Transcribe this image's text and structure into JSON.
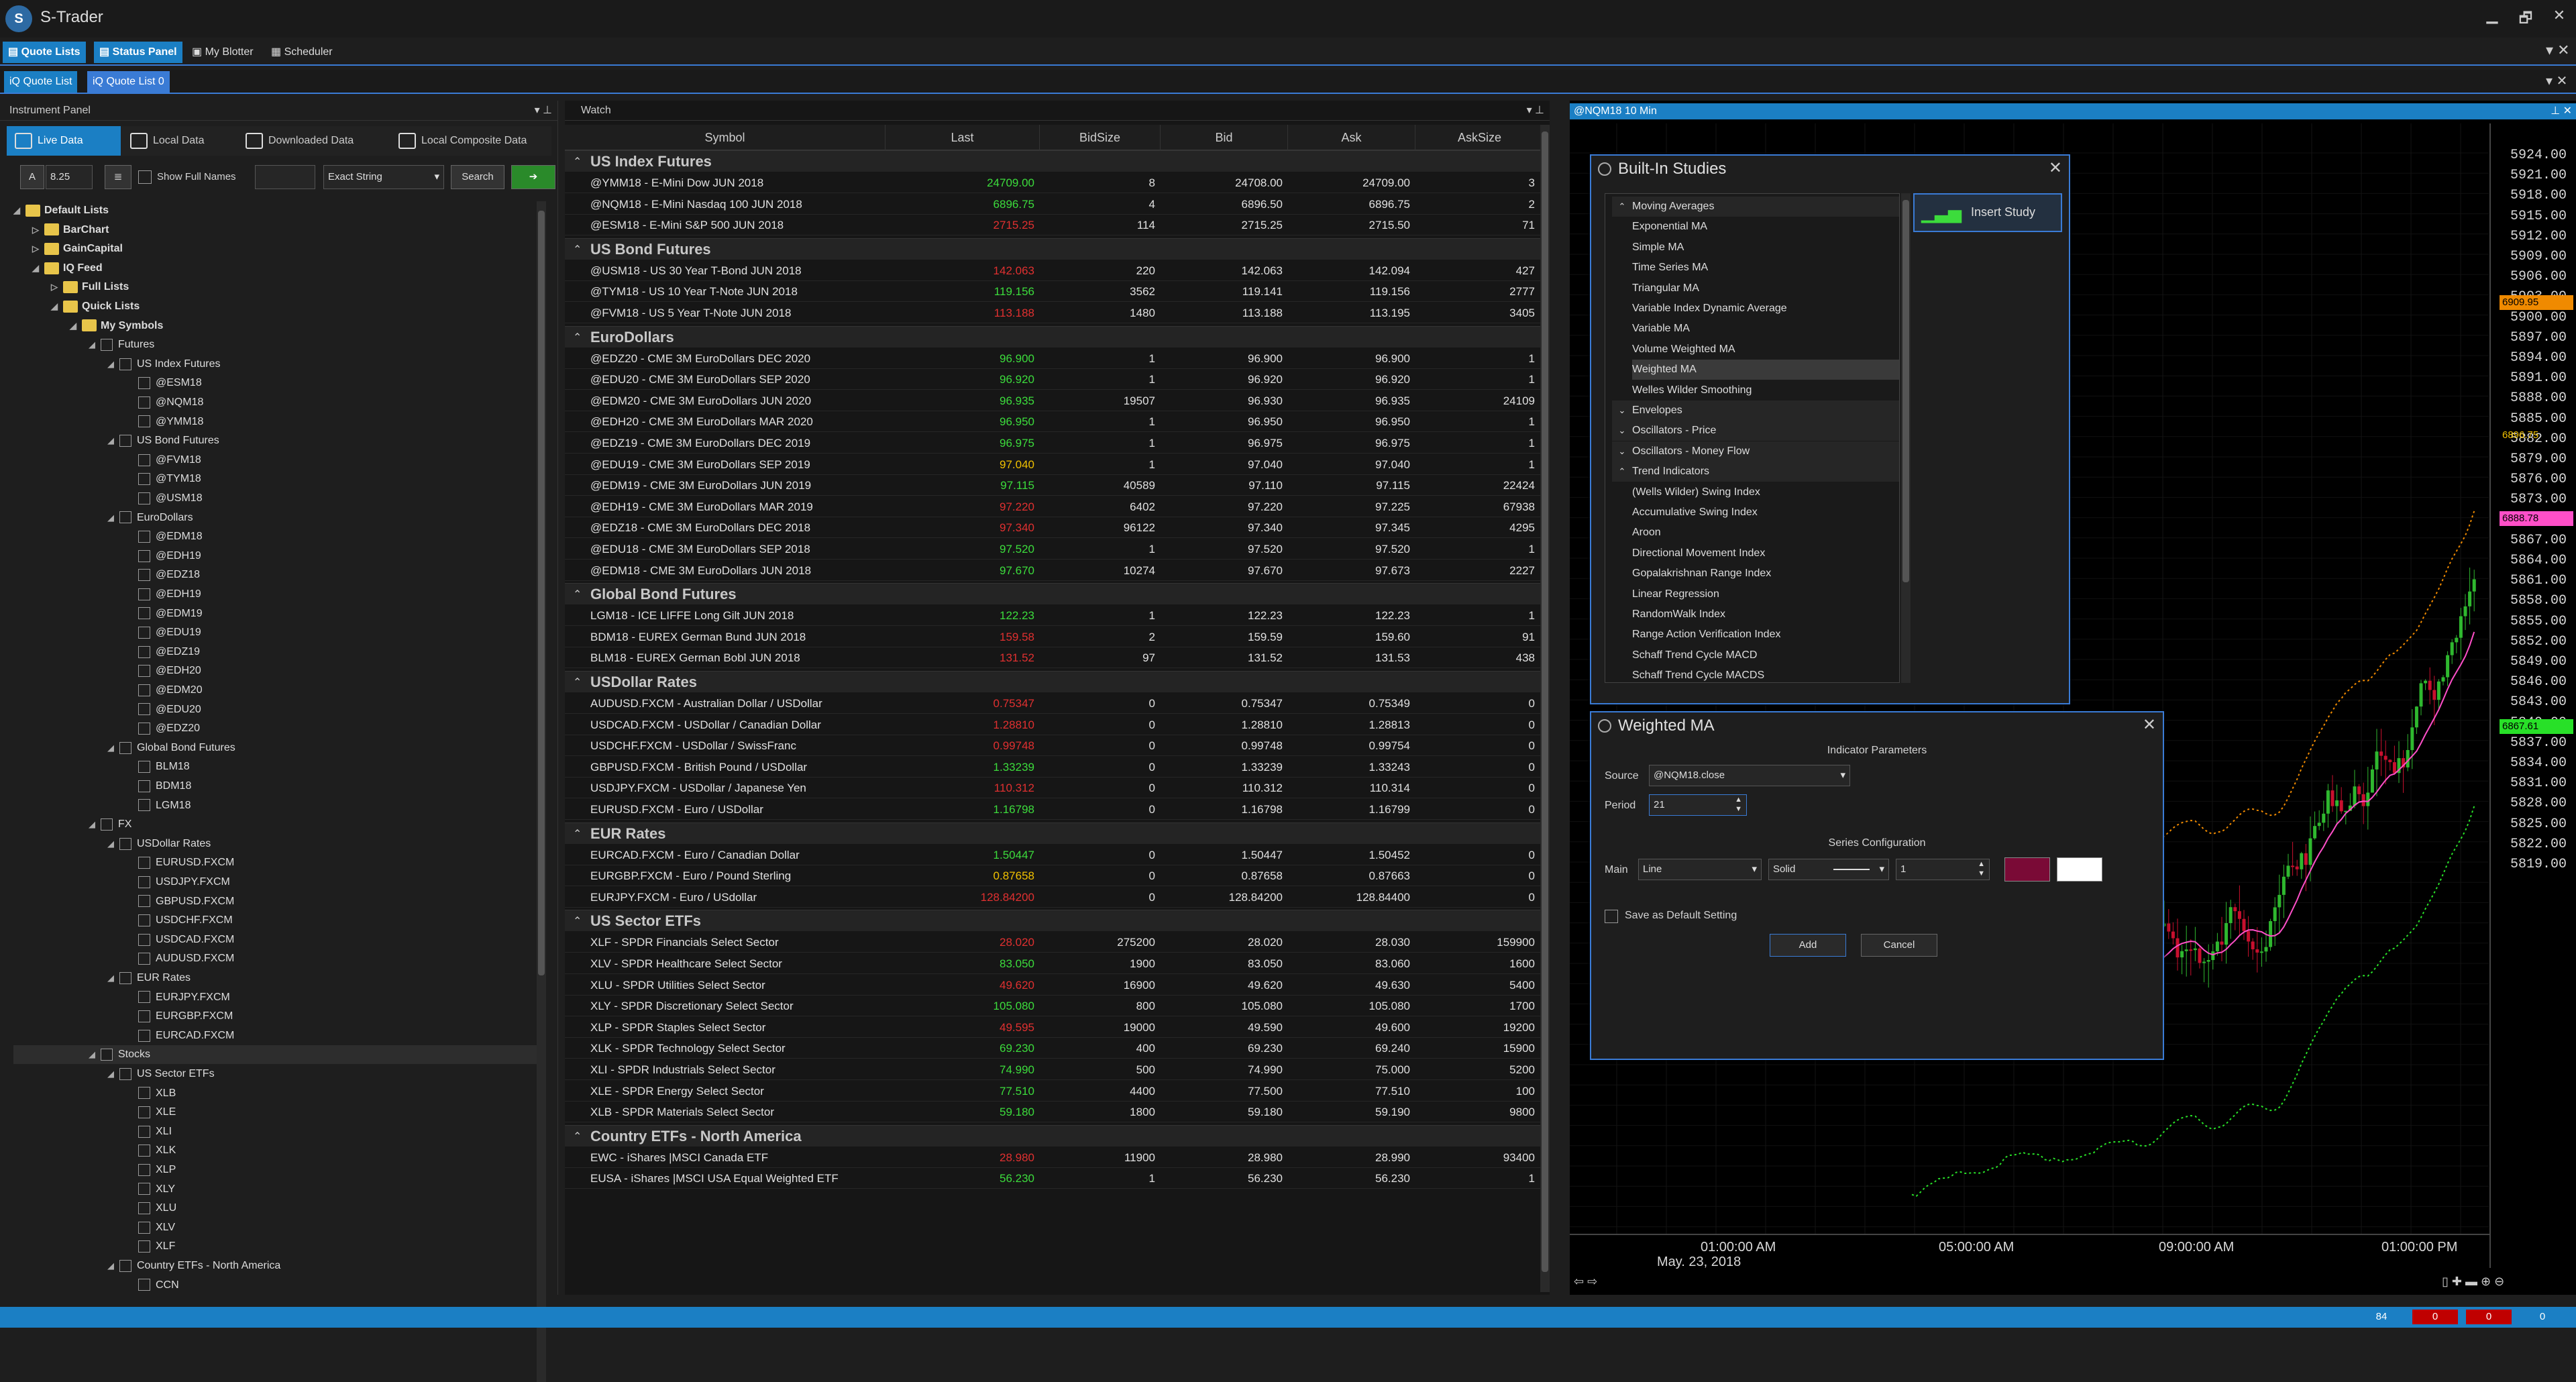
{
  "app": {
    "title": "S-Trader"
  },
  "window_controls": {
    "minimize": "▁",
    "maximize": "🗗",
    "close": "✕"
  },
  "toolbar": {
    "items": [
      {
        "label": "Quote Lists",
        "icon": "quote-list-icon"
      },
      {
        "label": "Status Panel",
        "icon": "status-panel-icon"
      },
      {
        "label": "My Blotter",
        "icon": "blotter-icon"
      },
      {
        "label": "Scheduler",
        "icon": "scheduler-icon"
      }
    ]
  },
  "doc_tabs": [
    {
      "label": "Quote List"
    },
    {
      "label": "Quote List 0"
    }
  ],
  "instrument_panel": {
    "title": "Instrument Panel",
    "source_tabs": [
      {
        "label": "Live Data"
      },
      {
        "label": "Local Data"
      },
      {
        "label": "Downloaded Data"
      },
      {
        "label": "Local Composite Data"
      }
    ],
    "font_size": "8.25",
    "show_full_names": "Show Full Names",
    "search_mode": "Exact String",
    "search_button": "Search",
    "tree": [
      {
        "label": "Default Lists",
        "level": 0,
        "arrow": "◢",
        "bold": true,
        "box": "folder"
      },
      {
        "label": "BarChart",
        "level": 1,
        "arrow": "▷",
        "bold": true,
        "box": "folder"
      },
      {
        "label": "GainCapital",
        "level": 1,
        "arrow": "▷",
        "bold": true,
        "box": "folder"
      },
      {
        "label": "IQ Feed",
        "level": 1,
        "arrow": "◢",
        "bold": true,
        "box": "folder"
      },
      {
        "label": "Full Lists",
        "level": 2,
        "arrow": "▷",
        "bold": true,
        "box": "folder"
      },
      {
        "label": "Quick Lists",
        "level": 2,
        "arrow": "◢",
        "bold": true,
        "box": "folder"
      },
      {
        "label": "My Symbols",
        "level": 3,
        "arrow": "◢",
        "bold": true,
        "box": "folder"
      },
      {
        "label": "Futures",
        "level": 4,
        "arrow": "◢",
        "box": "check"
      },
      {
        "label": "US Index Futures",
        "level": 5,
        "arrow": "◢",
        "box": "check"
      },
      {
        "label": "@ESM18",
        "level": 6,
        "box": "check"
      },
      {
        "label": "@NQM18",
        "level": 6,
        "box": "check"
      },
      {
        "label": "@YMM18",
        "level": 6,
        "box": "check"
      },
      {
        "label": "US Bond Futures",
        "level": 5,
        "arrow": "◢",
        "box": "check"
      },
      {
        "label": "@FVM18",
        "level": 6,
        "box": "check"
      },
      {
        "label": "@TYM18",
        "level": 6,
        "box": "check"
      },
      {
        "label": "@USM18",
        "level": 6,
        "box": "check"
      },
      {
        "label": "EuroDollars",
        "level": 5,
        "arrow": "◢",
        "box": "check"
      },
      {
        "label": "@EDM18",
        "level": 6,
        "box": "check"
      },
      {
        "label": "@EDH19",
        "level": 6,
        "box": "check"
      },
      {
        "label": "@EDZ18",
        "level": 6,
        "box": "check"
      },
      {
        "label": "@EDH19",
        "level": 6,
        "box": "check"
      },
      {
        "label": "@EDM19",
        "level": 6,
        "box": "check"
      },
      {
        "label": "@EDU19",
        "level": 6,
        "box": "check"
      },
      {
        "label": "@EDZ19",
        "level": 6,
        "box": "check"
      },
      {
        "label": "@EDH20",
        "level": 6,
        "box": "check"
      },
      {
        "label": "@EDM20",
        "level": 6,
        "box": "check"
      },
      {
        "label": "@EDU20",
        "level": 6,
        "box": "check"
      },
      {
        "label": "@EDZ20",
        "level": 6,
        "box": "check"
      },
      {
        "label": "Global Bond Futures",
        "level": 5,
        "arrow": "◢",
        "box": "check"
      },
      {
        "label": "BLM18",
        "level": 6,
        "box": "check"
      },
      {
        "label": "BDM18",
        "level": 6,
        "box": "check"
      },
      {
        "label": "LGM18",
        "level": 6,
        "box": "check"
      },
      {
        "label": "FX",
        "level": 4,
        "arrow": "◢",
        "box": "check"
      },
      {
        "label": "USDollar Rates",
        "level": 5,
        "arrow": "◢",
        "box": "check"
      },
      {
        "label": "EURUSD.FXCM",
        "level": 6,
        "box": "check"
      },
      {
        "label": "USDJPY.FXCM",
        "level": 6,
        "box": "check"
      },
      {
        "label": "GBPUSD.FXCM",
        "level": 6,
        "box": "check"
      },
      {
        "label": "USDCHF.FXCM",
        "level": 6,
        "box": "check"
      },
      {
        "label": "USDCAD.FXCM",
        "level": 6,
        "box": "check"
      },
      {
        "label": "AUDUSD.FXCM",
        "level": 6,
        "box": "check"
      },
      {
        "label": "EUR Rates",
        "level": 5,
        "arrow": "◢",
        "box": "check"
      },
      {
        "label": "EURJPY.FXCM",
        "level": 6,
        "box": "check"
      },
      {
        "label": "EURGBP.FXCM",
        "level": 6,
        "box": "check"
      },
      {
        "label": "EURCAD.FXCM",
        "level": 6,
        "box": "check"
      },
      {
        "label": "Stocks",
        "level": 4,
        "arrow": "◢",
        "box": "check",
        "selected": true
      },
      {
        "label": "US Sector ETFs",
        "level": 5,
        "arrow": "◢",
        "box": "check"
      },
      {
        "label": "XLB",
        "level": 6,
        "box": "check"
      },
      {
        "label": "XLE",
        "level": 6,
        "box": "check"
      },
      {
        "label": "XLI",
        "level": 6,
        "box": "check"
      },
      {
        "label": "XLK",
        "level": 6,
        "box": "check"
      },
      {
        "label": "XLP",
        "level": 6,
        "box": "check"
      },
      {
        "label": "XLY",
        "level": 6,
        "box": "check"
      },
      {
        "label": "XLU",
        "level": 6,
        "box": "check"
      },
      {
        "label": "XLV",
        "level": 6,
        "box": "check"
      },
      {
        "label": "XLF",
        "level": 6,
        "box": "check"
      },
      {
        "label": "Country ETFs - North America",
        "level": 5,
        "arrow": "◢",
        "box": "check"
      },
      {
        "label": "CCN",
        "level": 6,
        "box": "check"
      }
    ]
  },
  "watch": {
    "title": "Watch",
    "columns": [
      "Symbol",
      "Last",
      "BidSize",
      "Bid",
      "Ask",
      "AskSize"
    ],
    "groups": [
      {
        "name": "US Index Futures",
        "rows": [
          [
            "@YMM18 - E-Mini Dow JUN 2018",
            "24709.00",
            "8",
            "24708.00",
            "24709.00",
            "3",
            "up"
          ],
          [
            "@NQM18 - E-Mini Nasdaq 100 JUN 2018",
            "6896.75",
            "4",
            "6896.50",
            "6896.75",
            "2",
            "up"
          ],
          [
            "@ESM18 - E-Mini S&P 500 JUN 2018",
            "2715.25",
            "114",
            "2715.25",
            "2715.50",
            "71",
            "dn"
          ]
        ]
      },
      {
        "name": "US Bond Futures",
        "rows": [
          [
            "@USM18 - US 30 Year T-Bond JUN 2018",
            "142.063",
            "220",
            "142.063",
            "142.094",
            "427",
            "dn"
          ],
          [
            "@TYM18 - US 10 Year T-Note JUN 2018",
            "119.156",
            "3562",
            "119.141",
            "119.156",
            "2777",
            "up"
          ],
          [
            "@FVM18 - US 5 Year T-Note JUN 2018",
            "113.188",
            "1480",
            "113.188",
            "113.195",
            "3405",
            "dn"
          ]
        ]
      },
      {
        "name": "EuroDollars",
        "rows": [
          [
            "@EDZ20 - CME 3M EuroDollars DEC 2020",
            "96.900",
            "1",
            "96.900",
            "96.900",
            "1",
            "up"
          ],
          [
            "@EDU20 - CME 3M EuroDollars SEP 2020",
            "96.920",
            "1",
            "96.920",
            "96.920",
            "1",
            "up"
          ],
          [
            "@EDM20 - CME 3M EuroDollars JUN 2020",
            "96.935",
            "19507",
            "96.930",
            "96.935",
            "24109",
            "up"
          ],
          [
            "@EDH20 - CME 3M EuroDollars MAR 2020",
            "96.950",
            "1",
            "96.950",
            "96.950",
            "1",
            "up"
          ],
          [
            "@EDZ19 - CME 3M EuroDollars DEC 2019",
            "96.975",
            "1",
            "96.975",
            "96.975",
            "1",
            "up"
          ],
          [
            "@EDU19 - CME 3M EuroDollars SEP 2019",
            "97.040",
            "1",
            "97.040",
            "97.040",
            "1",
            "flat"
          ],
          [
            "@EDM19 - CME 3M EuroDollars JUN 2019",
            "97.115",
            "40589",
            "97.110",
            "97.115",
            "22424",
            "up"
          ],
          [
            "@EDH19 - CME 3M EuroDollars MAR 2019",
            "97.220",
            "6402",
            "97.220",
            "97.225",
            "67938",
            "dn"
          ],
          [
            "@EDZ18 - CME 3M EuroDollars DEC 2018",
            "97.340",
            "96122",
            "97.340",
            "97.345",
            "4295",
            "dn"
          ],
          [
            "@EDU18 - CME 3M EuroDollars SEP 2018",
            "97.520",
            "1",
            "97.520",
            "97.520",
            "1",
            "up"
          ],
          [
            "@EDM18 - CME 3M EuroDollars JUN 2018",
            "97.670",
            "10274",
            "97.670",
            "97.673",
            "2227",
            "up"
          ]
        ]
      },
      {
        "name": "Global Bond Futures",
        "rows": [
          [
            "LGM18 - ICE LIFFE Long Gilt JUN 2018",
            "122.23",
            "1",
            "122.23",
            "122.23",
            "1",
            "up"
          ],
          [
            "BDM18 - EUREX German Bund JUN 2018",
            "159.58",
            "2",
            "159.59",
            "159.60",
            "91",
            "dn"
          ],
          [
            "BLM18 - EUREX German Bobl JUN 2018",
            "131.52",
            "97",
            "131.52",
            "131.53",
            "438",
            "dn"
          ]
        ]
      },
      {
        "name": "USDollar Rates",
        "rows": [
          [
            "AUDUSD.FXCM - Australian Dollar / USDollar",
            "0.75347",
            "0",
            "0.75347",
            "0.75349",
            "0",
            "dn"
          ],
          [
            "USDCAD.FXCM - USDollar / Canadian Dollar",
            "1.28810",
            "0",
            "1.28810",
            "1.28813",
            "0",
            "dn"
          ],
          [
            "USDCHF.FXCM - USDollar / SwissFranc",
            "0.99748",
            "0",
            "0.99748",
            "0.99754",
            "0",
            "dn"
          ],
          [
            "GBPUSD.FXCM - British Pound / USDollar",
            "1.33239",
            "0",
            "1.33239",
            "1.33243",
            "0",
            "up"
          ],
          [
            "USDJPY.FXCM - USDollar / Japanese Yen",
            "110.312",
            "0",
            "110.312",
            "110.314",
            "0",
            "dn"
          ],
          [
            "EURUSD.FXCM - Euro / USDollar",
            "1.16798",
            "0",
            "1.16798",
            "1.16799",
            "0",
            "up"
          ]
        ]
      },
      {
        "name": "EUR Rates",
        "rows": [
          [
            "EURCAD.FXCM - Euro / Canadian Dollar",
            "1.50447",
            "0",
            "1.50447",
            "1.50452",
            "0",
            "up"
          ],
          [
            "EURGBP.FXCM - Euro / Pound Sterling",
            "0.87658",
            "0",
            "0.87658",
            "0.87663",
            "0",
            "flat"
          ],
          [
            "EURJPY.FXCM - Euro / USdollar",
            "128.84200",
            "0",
            "128.84200",
            "128.84400",
            "0",
            "dn"
          ]
        ]
      },
      {
        "name": "US Sector ETFs",
        "rows": [
          [
            "XLF - SPDR Financials Select Sector",
            "28.020",
            "275200",
            "28.020",
            "28.030",
            "159900",
            "dn"
          ],
          [
            "XLV - SPDR Healthcare Select Sector",
            "83.050",
            "1900",
            "83.050",
            "83.060",
            "1600",
            "up"
          ],
          [
            "XLU - SPDR Utilities Select Sector",
            "49.620",
            "16900",
            "49.620",
            "49.630",
            "5400",
            "dn"
          ],
          [
            "XLY - SPDR Discretionary Select Sector",
            "105.080",
            "800",
            "105.080",
            "105.080",
            "1700",
            "up"
          ],
          [
            "XLP - SPDR Staples Select Sector",
            "49.595",
            "19000",
            "49.590",
            "49.600",
            "19200",
            "dn"
          ],
          [
            "XLK - SPDR Technology Select Sector",
            "69.230",
            "400",
            "69.230",
            "69.240",
            "15900",
            "up"
          ],
          [
            "XLI - SPDR Industrials Select Sector",
            "74.990",
            "500",
            "74.990",
            "75.000",
            "5200",
            "up"
          ],
          [
            "XLE - SPDR Energy Select Sector",
            "77.510",
            "4400",
            "77.500",
            "77.510",
            "100",
            "up"
          ],
          [
            "XLB - SPDR Materials Select Sector",
            "59.180",
            "1800",
            "59.180",
            "59.190",
            "9800",
            "up"
          ]
        ]
      },
      {
        "name": "Country ETFs - North America",
        "rows": [
          [
            "EWC - iShares |MSCI Canada ETF",
            "28.980",
            "11900",
            "28.980",
            "28.990",
            "93400",
            "dn"
          ],
          [
            "EUSA - iShares |MSCI USA Equal Weighted ETF",
            "56.230",
            "1",
            "56.230",
            "56.230",
            "1",
            "up"
          ]
        ]
      }
    ]
  },
  "chart": {
    "title": "@NQM18 10 Min",
    "price_labels": [
      "5924.00",
      "5921.00",
      "5918.00",
      "5915.00",
      "5912.00",
      "5909.00",
      "5906.00",
      "5903.00",
      "5900.00",
      "5897.00",
      "5894.00",
      "5891.00",
      "5888.00",
      "5885.00",
      "5882.00",
      "5879.00",
      "5876.00",
      "5873.00",
      "5870.00",
      "5867.00",
      "5864.00",
      "5861.00",
      "5858.00",
      "5855.00",
      "5852.00",
      "5849.00",
      "5846.00",
      "5843.00",
      "5840.00",
      "5837.00",
      "5834.00",
      "5831.00",
      "5828.00",
      "5825.00",
      "5822.00",
      "5819.00"
    ],
    "time_labels": [
      "01:00:00 AM",
      "05:00:00 AM",
      "09:00:00 AM",
      "01:00:00 PM"
    ],
    "date_label": "May. 23, 2018",
    "tags": [
      {
        "text": "6909.95",
        "color": "#f08a00"
      },
      {
        "text": "6896.75",
        "color": "#000000"
      },
      {
        "text": "6888.78",
        "color": "#ff4fc8"
      },
      {
        "text": "6867.61",
        "color": "#28e028"
      }
    ],
    "colors": {
      "up": "#2fb82f",
      "down": "#c8102e",
      "ma_pink": "#ff4fc8",
      "upper_band": "#f08a00",
      "lower_band": "#28e028"
    }
  },
  "builtin_studies": {
    "title": "Built-In Studies",
    "insert_label": "Insert Study",
    "items": [
      {
        "kind": "cat",
        "label": "Moving Averages",
        "open": true
      },
      {
        "kind": "item",
        "label": "Exponential MA"
      },
      {
        "kind": "item",
        "label": "Simple MA"
      },
      {
        "kind": "item",
        "label": "Time Series MA"
      },
      {
        "kind": "item",
        "label": "Triangular MA"
      },
      {
        "kind": "item",
        "label": "Variable Index Dynamic Average"
      },
      {
        "kind": "item",
        "label": "Variable MA"
      },
      {
        "kind": "item",
        "label": "Volume Weighted MA"
      },
      {
        "kind": "item",
        "label": "Weighted MA",
        "selected": true
      },
      {
        "kind": "item",
        "label": "Welles Wilder Smoothing"
      },
      {
        "kind": "cat",
        "label": "Envelopes"
      },
      {
        "kind": "cat",
        "label": "Oscillators - Price"
      },
      {
        "kind": "cat",
        "label": "Oscillators - Money Flow"
      },
      {
        "kind": "cat",
        "label": "Trend Indicators",
        "open": true
      },
      {
        "kind": "item",
        "label": "(Wells Wilder) Swing Index"
      },
      {
        "kind": "item",
        "label": "Accumulative Swing Index"
      },
      {
        "kind": "item",
        "label": "Aroon"
      },
      {
        "kind": "item",
        "label": "Directional Movement Index"
      },
      {
        "kind": "item",
        "label": "Gopalakrishnan Range Index"
      },
      {
        "kind": "item",
        "label": "Linear Regression"
      },
      {
        "kind": "item",
        "label": "RandomWalk Index"
      },
      {
        "kind": "item",
        "label": "Range Action Verification Index"
      },
      {
        "kind": "item",
        "label": "Schaff Trend Cycle MACD"
      },
      {
        "kind": "item",
        "label": "Schaff Trend Cycle MACDS"
      }
    ]
  },
  "weighted_ma": {
    "title": "Weighted MA",
    "section_params": "Indicator Parameters",
    "source_label": "Source",
    "source_value": "@NQM18.close",
    "period_label": "Period",
    "period_value": "21",
    "section_series": "Series Configuration",
    "main_label": "Main",
    "series_type": "Line",
    "line_style": "Solid",
    "line_width": "1",
    "series_color": "#7a0a36",
    "save_default": "Save as Default Setting",
    "add": "Add",
    "cancel": "Cancel"
  },
  "status": {
    "values": [
      "84",
      "0",
      "0",
      "0"
    ],
    "colors": [
      "#1b7fc4",
      "#c00000",
      "#c00000",
      "#1b7fc4"
    ]
  }
}
